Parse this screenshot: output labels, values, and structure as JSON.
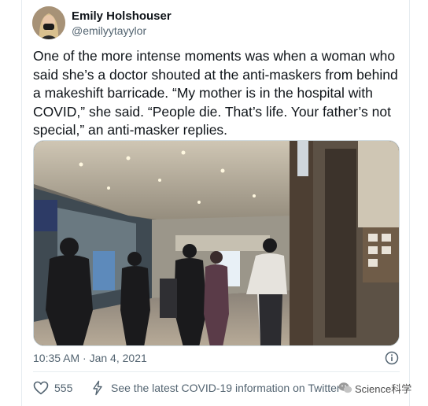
{
  "tweet": {
    "author": {
      "display_name": "Emily Holshouser",
      "handle": "@emilyytayylor",
      "avatar_icon": "user-avatar-photo"
    },
    "text": "One of the more intense moments was when a woman who said she’s a doctor shouted at the anti-maskers from behind a makeshift barricade. “My mother is in the hospital with COVID,” she said. “People die. That’s life. Your father’s not special,” an anti-masker replies.",
    "media": {
      "type": "video-still",
      "description_icon": "mall-interior-video-frame"
    },
    "timestamp": "10:35 AM · Jan 4, 2021",
    "likes": {
      "count": "555",
      "icon": "heart-outline-icon"
    },
    "covid_info": {
      "icon": "lightning-bolt-icon",
      "text": "See the latest COVID-19 information on Twitter"
    },
    "info_icon": "info-circle-icon"
  },
  "watermark": {
    "text": "Science科学",
    "icon": "wechat-icon"
  },
  "colors": {
    "text_primary": "#0f1419",
    "text_secondary": "#536471",
    "border": "#e6ecf0",
    "background": "#ffffff"
  }
}
